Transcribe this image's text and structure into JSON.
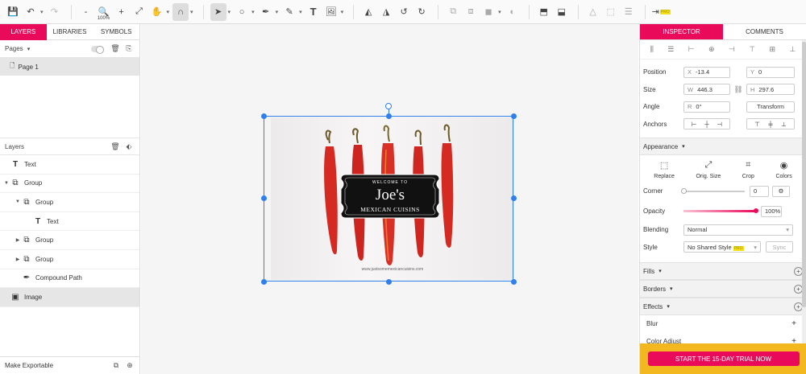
{
  "toolbar": {
    "zoom_label": "100%",
    "pro_badge": "PRO"
  },
  "left": {
    "tabs": [
      "LAYERS",
      "LIBRARIES",
      "SYMBOLS"
    ],
    "pages_label": "Pages",
    "page_item": "Page 1",
    "layers_label": "Layers",
    "layers": [
      {
        "name": "Text",
        "depth": 0,
        "twist": "",
        "icon": "text-icon"
      },
      {
        "name": "Group",
        "depth": 0,
        "twist": "open",
        "icon": "group-icon"
      },
      {
        "name": "Group",
        "depth": 1,
        "twist": "open",
        "icon": "group-icon"
      },
      {
        "name": "Text",
        "depth": 2,
        "twist": "",
        "icon": "text-icon"
      },
      {
        "name": "Group",
        "depth": 1,
        "twist": "closed",
        "icon": "group-icon"
      },
      {
        "name": "Group",
        "depth": 1,
        "twist": "closed",
        "icon": "group-icon"
      },
      {
        "name": "Compound Path",
        "depth": 1,
        "twist": "",
        "icon": "pen-icon"
      },
      {
        "name": "Image",
        "depth": 0,
        "twist": "",
        "icon": "image-icon"
      }
    ],
    "footer_label": "Make Exportable"
  },
  "artwork": {
    "welcome": "WELCOME TO",
    "name": "Joe's",
    "subtitle": "MEXICAN CUISINS",
    "url": "www.justsomemexicancuisins.com"
  },
  "inspector": {
    "tabs": [
      "INSPECTOR",
      "COMMENTS"
    ],
    "position_label": "Position",
    "x_key": "X",
    "x_value": "-13.4",
    "y_key": "Y",
    "y_value": "0",
    "size_label": "Size",
    "w_key": "W",
    "w_value": "446.3",
    "h_key": "H",
    "h_value": "297.6",
    "angle_label": "Angle",
    "r_key": "R",
    "r_value": "0°",
    "transform_label": "Transform",
    "anchors_label": "Anchors",
    "appearance_label": "Appearance",
    "tools": [
      "Replace",
      "Orig. Size",
      "Crop",
      "Colors"
    ],
    "corner_label": "Corner",
    "corner_value": "0",
    "opacity_label": "Opacity",
    "opacity_value": "100%",
    "opacity_fraction": 1.0,
    "blending_label": "Blending",
    "blending_value": "Normal",
    "style_label": "Style",
    "style_value": "No Shared Style",
    "style_pro": "PRO",
    "sync_label": "Sync",
    "fills_label": "Fills",
    "borders_label": "Borders",
    "effects_label": "Effects",
    "blur_label": "Blur",
    "color_adjust_label": "Color Adjust",
    "cta_label": "START THE 15-DAY TRIAL NOW"
  },
  "colors": {
    "accent": "#ea0a5a",
    "selection": "#2f80ed",
    "cta_bg": "#f3b81f",
    "pepper": "#d42a22"
  }
}
